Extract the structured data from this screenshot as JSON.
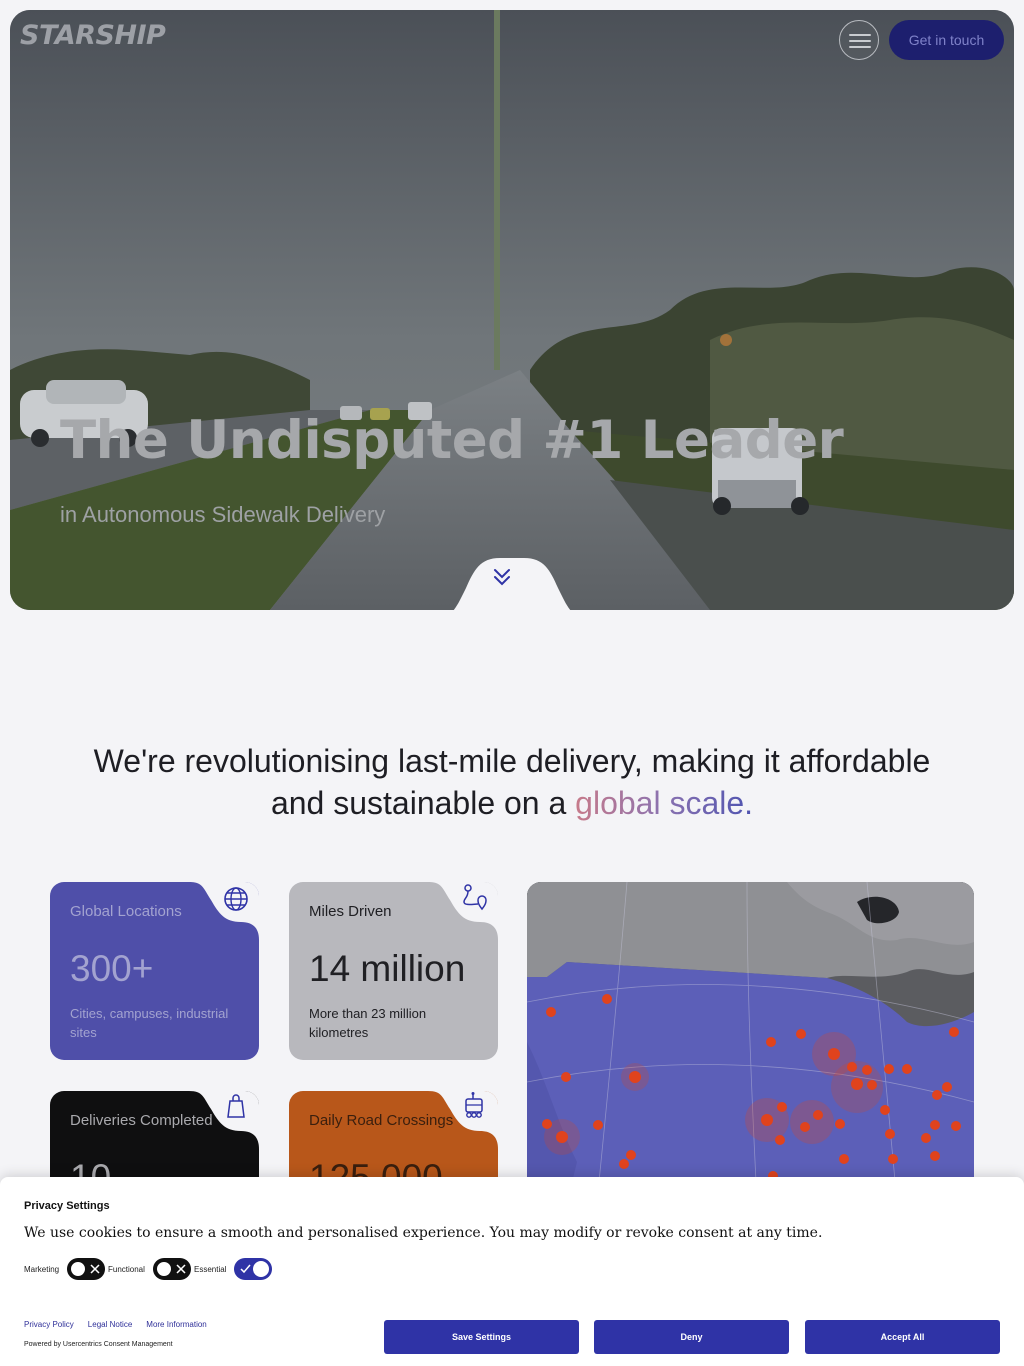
{
  "brand": {
    "logo_text": "STARSHIP"
  },
  "header": {
    "menu_icon": "hamburger-icon",
    "cta_label": "Get in touch"
  },
  "hero": {
    "title": "The Undisputed #1 Leader",
    "subtitle": "in Autonomous Sidewalk Delivery",
    "scroll_icon": "double-chevron-down-icon"
  },
  "tagline": {
    "line1": "We're revolutionising last-mile delivery, making it affordable",
    "line2_prefix": "and sustainable on a ",
    "line2_accent": "global scale."
  },
  "stats": {
    "locations": {
      "label": "Global Locations",
      "value": "300+",
      "desc": "Cities, campuses, industrial sites",
      "icon": "globe-icon"
    },
    "miles": {
      "label": "Miles Driven",
      "value": "14 million",
      "desc": "More than 23 million kilometres",
      "icon": "route-pin-icon"
    },
    "deliveries": {
      "label": "Deliveries Completed",
      "value": "10",
      "icon": "shopping-bag-icon"
    },
    "crossings": {
      "label": "Daily Road Crossings",
      "value": "125,000",
      "icon": "robot-icon"
    }
  },
  "colors": {
    "accent": "#2f33a6",
    "card_blue": "#4f4fa9",
    "card_orange": "#b8571a",
    "map_dot": "#e0431d"
  },
  "consent": {
    "title": "Privacy Settings",
    "text": "We use cookies to ensure a smooth and personalised experience. You may modify or revoke consent at any time.",
    "toggles": [
      {
        "label": "Marketing",
        "on": false
      },
      {
        "label": "Functional",
        "on": false
      },
      {
        "label": "Essential",
        "on": true
      }
    ],
    "links": [
      "Privacy Policy",
      "Legal Notice",
      "More Information"
    ],
    "powered_by": "Powered by Usercentrics Consent Management",
    "buttons": {
      "save": "Save Settings",
      "deny": "Deny",
      "accept": "Accept All"
    }
  }
}
